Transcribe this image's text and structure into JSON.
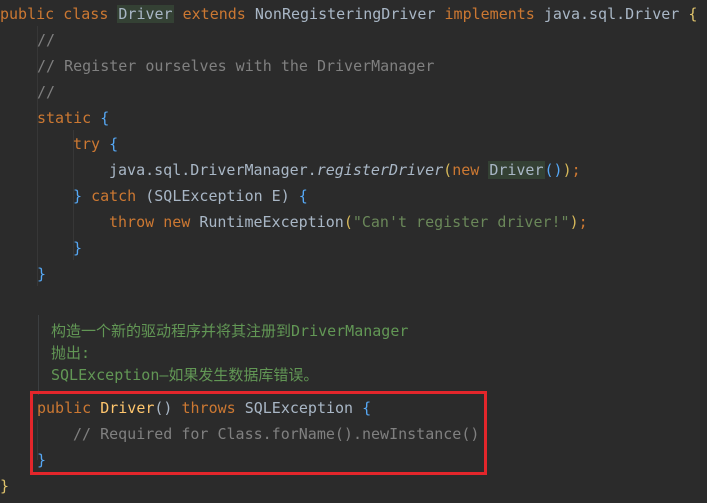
{
  "code": {
    "line1": {
      "kw_public": "public",
      "kw_class": "class",
      "class_name": "Driver",
      "kw_extends": "extends",
      "parent": "NonRegisteringDriver",
      "kw_implements": "implements",
      "iface": "java.sql.Driver",
      "open_brace": "{"
    },
    "line2_comment": "//",
    "line3_comment": "// Register ourselves with the DriverManager",
    "line4_comment": "//",
    "line5": {
      "kw_static": "static",
      "brace": "{"
    },
    "line6": {
      "kw_try": "try",
      "brace": "{"
    },
    "line7": {
      "prefix": "java.sql.DriverManager.",
      "method": "registerDriver",
      "paren_open": "(",
      "kw_new": "new",
      "ctor": "Driver",
      "inner_parens": "()",
      "paren_close": ")",
      "semicolon": ";"
    },
    "line8": {
      "close_brace": "}",
      "kw_catch": "catch",
      "paren_open": "(",
      "exc_type": "SQLException E",
      "paren_close": ")",
      "open_brace": "{"
    },
    "line9": {
      "kw_throw": "throw",
      "kw_new": "new",
      "exc": "RuntimeException",
      "paren_open": "(",
      "string": "\"Can't register driver!\"",
      "paren_close": ")",
      "semicolon": ";"
    },
    "line10_brace": "}",
    "line11_brace": "}",
    "doc": {
      "line1": "构造一个新的驱动程序并将其注册到DriverManager",
      "line2": "抛出:",
      "line3": "SQLException—如果发生数据库错误。"
    },
    "line_ctor": {
      "kw_public": "public",
      "name": "Driver",
      "parens": "()",
      "kw_throws": "throws",
      "exc": "SQLException",
      "brace": "{"
    },
    "line_ctor_comment": "// Required for Class.forName().newInstance()",
    "line_ctor_close": "}",
    "line_final_close": "}"
  },
  "colors": {
    "background": "#2b2b2b",
    "keyword": "#cc7832",
    "comment": "#808080",
    "string": "#6a8759",
    "doc_comment": "#629755",
    "highlight_box": "#e3262b"
  }
}
